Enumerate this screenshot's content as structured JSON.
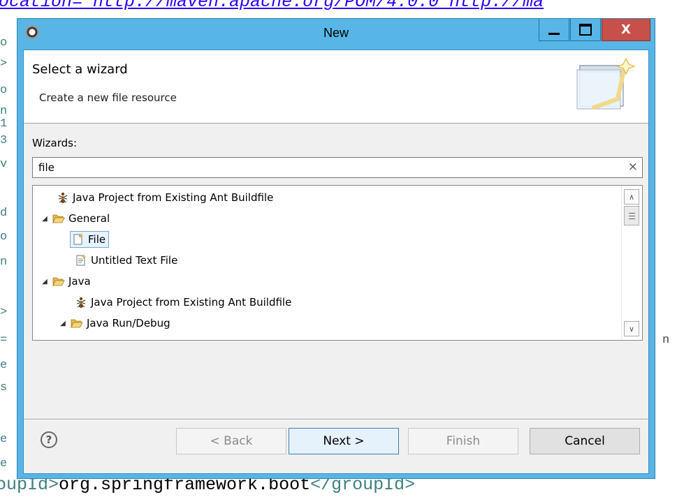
{
  "background_editor": {
    "top_line": "ocation=\"http://maven.apache.org/POM/4.0.0 http://ma",
    "bottom_line_tag_open": "oupId>",
    "bottom_line_text": "org.springframework.boot",
    "bottom_line_tag_close": "</groupId>",
    "right_fragment": "n"
  },
  "dialog": {
    "title": "New",
    "close_glyph": "X",
    "header": {
      "title": "Select a wizard",
      "description": "Create a new file resource"
    },
    "wizards_label": "Wizards:",
    "filter": {
      "value": "file",
      "clear_glyph": "×"
    },
    "tree": {
      "row0": "Java Project from Existing Ant Buildfile",
      "row1": "General",
      "row2": "File",
      "row3": "Untitled Text File",
      "row4": "Java",
      "row5": "Java Project from Existing Ant Buildfile",
      "row6": "Java Run/Debug"
    },
    "buttons": {
      "help": "?",
      "back": "< Back",
      "next": "Next >",
      "finish": "Finish",
      "cancel": "Cancel"
    }
  },
  "colors": {
    "window_frame": "#57b6e6",
    "close_button": "#c7504b",
    "selection": "#e5f3ff",
    "default_button_border": "#3c7fb1"
  }
}
